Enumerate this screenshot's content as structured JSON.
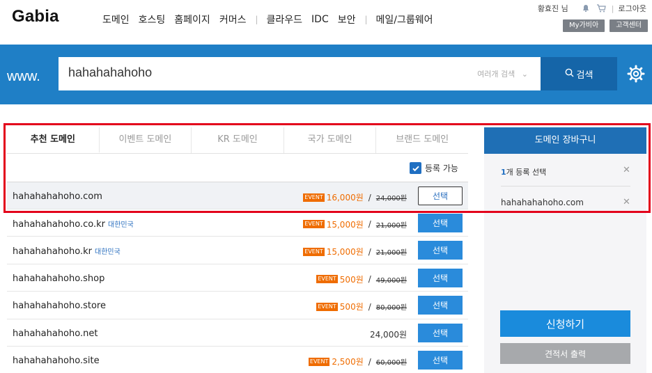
{
  "header": {
    "logo": "Gabia",
    "nav": [
      "도메인",
      "호스팅",
      "홈페이지",
      "커머스",
      "클라우드",
      "IDC",
      "보안",
      "메일/그룹웨어"
    ],
    "user": "황효진 님",
    "logout": "로그아웃",
    "my_gabia": "My가비아",
    "support": "고객센터"
  },
  "search": {
    "prefix": "www.",
    "query": "hahahahahoho",
    "multi_search": "여러개 검색",
    "button": "검색"
  },
  "tabs": [
    "추천 도메인",
    "이벤트 도메인",
    "KR 도메인",
    "국가 도메인",
    "브랜드 도메인"
  ],
  "filter": {
    "available_label": "등록 가능",
    "checked": true
  },
  "results": [
    {
      "domain": "hahahahahoho.com",
      "tag": "",
      "event": "EVENT",
      "price": "16,000원",
      "original": "24,000원",
      "button": "선택",
      "selected": true
    },
    {
      "domain": "hahahahahoho.co.kr",
      "tag": "대한민국",
      "event": "EVENT",
      "price": "15,000원",
      "original": "21,000원",
      "button": "선택",
      "selected": false
    },
    {
      "domain": "hahahahahoho.kr",
      "tag": "대한민국",
      "event": "EVENT",
      "price": "15,000원",
      "original": "21,000원",
      "button": "선택",
      "selected": false
    },
    {
      "domain": "hahahahahoho.shop",
      "tag": "",
      "event": "EVENT",
      "price": "500원",
      "original": "49,000원",
      "button": "선택",
      "selected": false
    },
    {
      "domain": "hahahahahoho.store",
      "tag": "",
      "event": "EVENT",
      "price": "500원",
      "original": "80,000원",
      "button": "선택",
      "selected": false
    },
    {
      "domain": "hahahahahoho.net",
      "tag": "",
      "event": "",
      "price": "24,000원",
      "original": "",
      "button": "선택",
      "selected": false
    },
    {
      "domain": "hahahahahoho.site",
      "tag": "",
      "event": "EVENT",
      "price": "2,500원",
      "original": "60,000원",
      "button": "선택",
      "selected": false
    }
  ],
  "cart": {
    "title": "도메인 장바구니",
    "count_num": "1",
    "count_text": "개 등록 선택",
    "item": "hahahahahoho.com",
    "apply": "신청하기",
    "quote": "견적서 출력"
  },
  "colors": {
    "banner": "#1f7fc6",
    "event": "#ef6c00",
    "highlight": "#e3001b",
    "cart_header": "#1f6fb5"
  },
  "icons": [
    "bell-icon",
    "cart-icon",
    "search-icon",
    "settings-gear-icon",
    "chevron-down-icon",
    "checkmark-icon",
    "close-icon"
  ]
}
